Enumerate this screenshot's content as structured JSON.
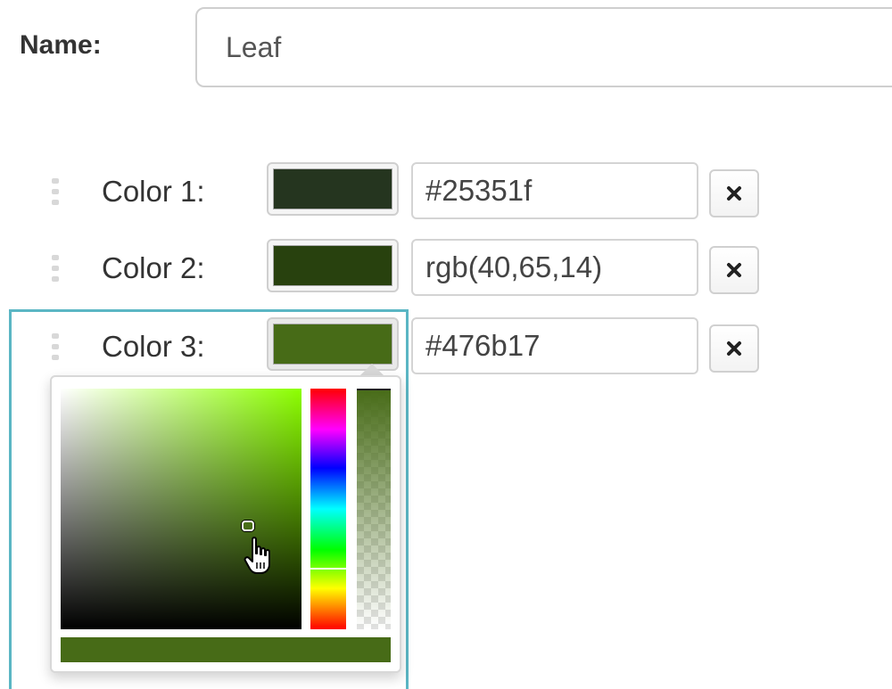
{
  "form": {
    "name_label": "Name:",
    "name_value": "Leaf"
  },
  "colors": [
    {
      "label": "Color 1:",
      "value": "#25351f",
      "swatch": "#25351f"
    },
    {
      "label": "Color 2:",
      "value": "rgb(40,65,14)",
      "swatch": "#28410e"
    },
    {
      "label": "Color 3:",
      "value": "#476b17",
      "swatch": "#476b17"
    }
  ],
  "picker": {
    "open_for": "Color 3:",
    "current_color": "#476b17",
    "hue_color": "#8cff00"
  },
  "icons": {
    "remove": "close-icon",
    "drag": "drag-handle-icon",
    "pointer": "hand-pointer-icon"
  },
  "accent": {
    "focus_outline": "#5bb6c4"
  }
}
